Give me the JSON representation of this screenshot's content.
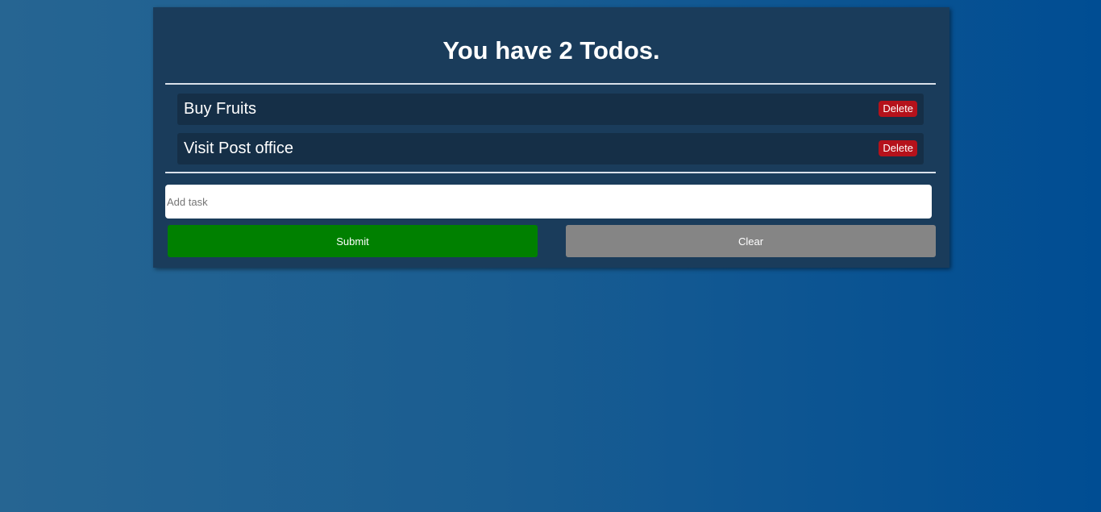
{
  "header": {
    "title": "You have 2 Todos."
  },
  "todos": [
    {
      "text": "Buy Fruits",
      "delete_label": "Delete"
    },
    {
      "text": "Visit Post office",
      "delete_label": "Delete"
    }
  ],
  "form": {
    "input_placeholder": "Add task",
    "input_value": "",
    "submit_label": "Submit",
    "clear_label": "Clear"
  },
  "colors": {
    "card_background": "#1a3c5b",
    "item_background": "#152f47",
    "delete_button": "#b5121b",
    "submit_button": "#008000",
    "clear_button": "#858585"
  }
}
